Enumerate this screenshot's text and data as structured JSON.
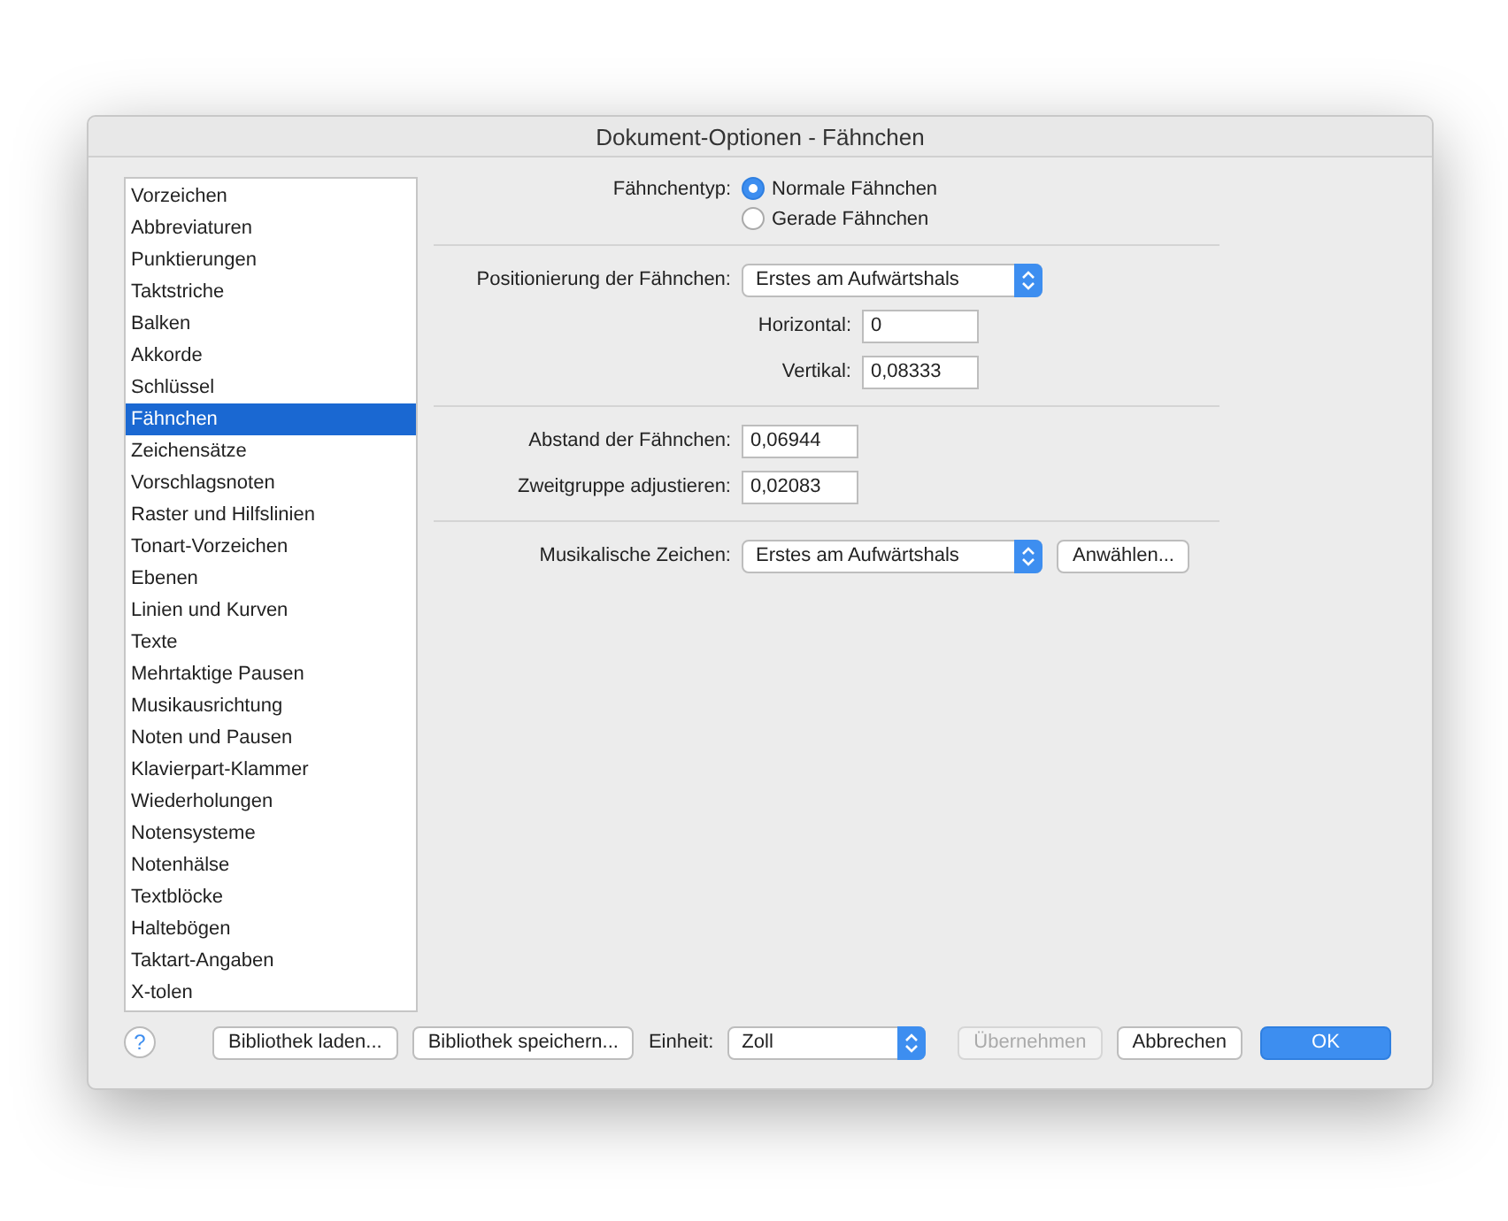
{
  "window": {
    "title": "Dokument-Optionen - Fähnchen"
  },
  "sidebar": {
    "items": [
      {
        "label": "Vorzeichen",
        "selected": false
      },
      {
        "label": "Abbreviaturen",
        "selected": false
      },
      {
        "label": "Punktierungen",
        "selected": false
      },
      {
        "label": "Taktstriche",
        "selected": false
      },
      {
        "label": "Balken",
        "selected": false
      },
      {
        "label": "Akkorde",
        "selected": false
      },
      {
        "label": "Schlüssel",
        "selected": false
      },
      {
        "label": "Fähnchen",
        "selected": true
      },
      {
        "label": "Zeichensätze",
        "selected": false
      },
      {
        "label": "Vorschlagsnoten",
        "selected": false
      },
      {
        "label": "Raster und Hilfslinien",
        "selected": false
      },
      {
        "label": "Tonart-Vorzeichen",
        "selected": false
      },
      {
        "label": "Ebenen",
        "selected": false
      },
      {
        "label": "Linien und Kurven",
        "selected": false
      },
      {
        "label": "Texte",
        "selected": false
      },
      {
        "label": "Mehrtaktige Pausen",
        "selected": false
      },
      {
        "label": "Musikausrichtung",
        "selected": false
      },
      {
        "label": "Noten und Pausen",
        "selected": false
      },
      {
        "label": "Klavierpart-Klammer",
        "selected": false
      },
      {
        "label": "Wiederholungen",
        "selected": false
      },
      {
        "label": "Notensysteme",
        "selected": false
      },
      {
        "label": "Notenhälse",
        "selected": false
      },
      {
        "label": "Textblöcke",
        "selected": false
      },
      {
        "label": "Haltebögen",
        "selected": false
      },
      {
        "label": "Taktart-Angaben",
        "selected": false
      },
      {
        "label": "X-tolen",
        "selected": false
      }
    ]
  },
  "sections": [
    [
      {
        "kind": "radio",
        "label": "Fähnchentyp:",
        "options": [
          {
            "label": "Normale Fähnchen",
            "selected": true
          },
          {
            "label": "Gerade Fähnchen",
            "selected": false
          }
        ]
      }
    ],
    [
      {
        "kind": "select",
        "label": "Positionierung der Fähnchen:",
        "value": "Erstes am Aufwärtshals"
      },
      {
        "kind": "subfield",
        "label": "Horizontal:",
        "value": "0"
      },
      {
        "kind": "subfield",
        "label": "Vertikal:",
        "value": "0,08333"
      }
    ],
    [
      {
        "kind": "field",
        "label": "Abstand der Fähnchen:",
        "value": "0,06944"
      },
      {
        "kind": "field",
        "label": "Zweitgruppe adjustieren:",
        "value": "0,02083"
      }
    ],
    [
      {
        "kind": "select",
        "label": "Musikalische Zeichen:",
        "value": "Erstes am Aufwärtshals",
        "button": "Anwählen..."
      }
    ]
  ],
  "footer": {
    "help": "?",
    "buttons": [
      {
        "label": "Bibliothek laden...",
        "disabled": false
      },
      {
        "label": "Bibliothek speichern...",
        "disabled": false
      }
    ],
    "unit_label": "Einheit:",
    "unit_value": "Zoll",
    "actions": [
      {
        "label": "Übernehmen",
        "disabled": true,
        "default": false
      },
      {
        "label": "Abbrechen",
        "disabled": false,
        "default": false
      },
      {
        "label": "OK",
        "disabled": false,
        "default": true
      }
    ]
  }
}
